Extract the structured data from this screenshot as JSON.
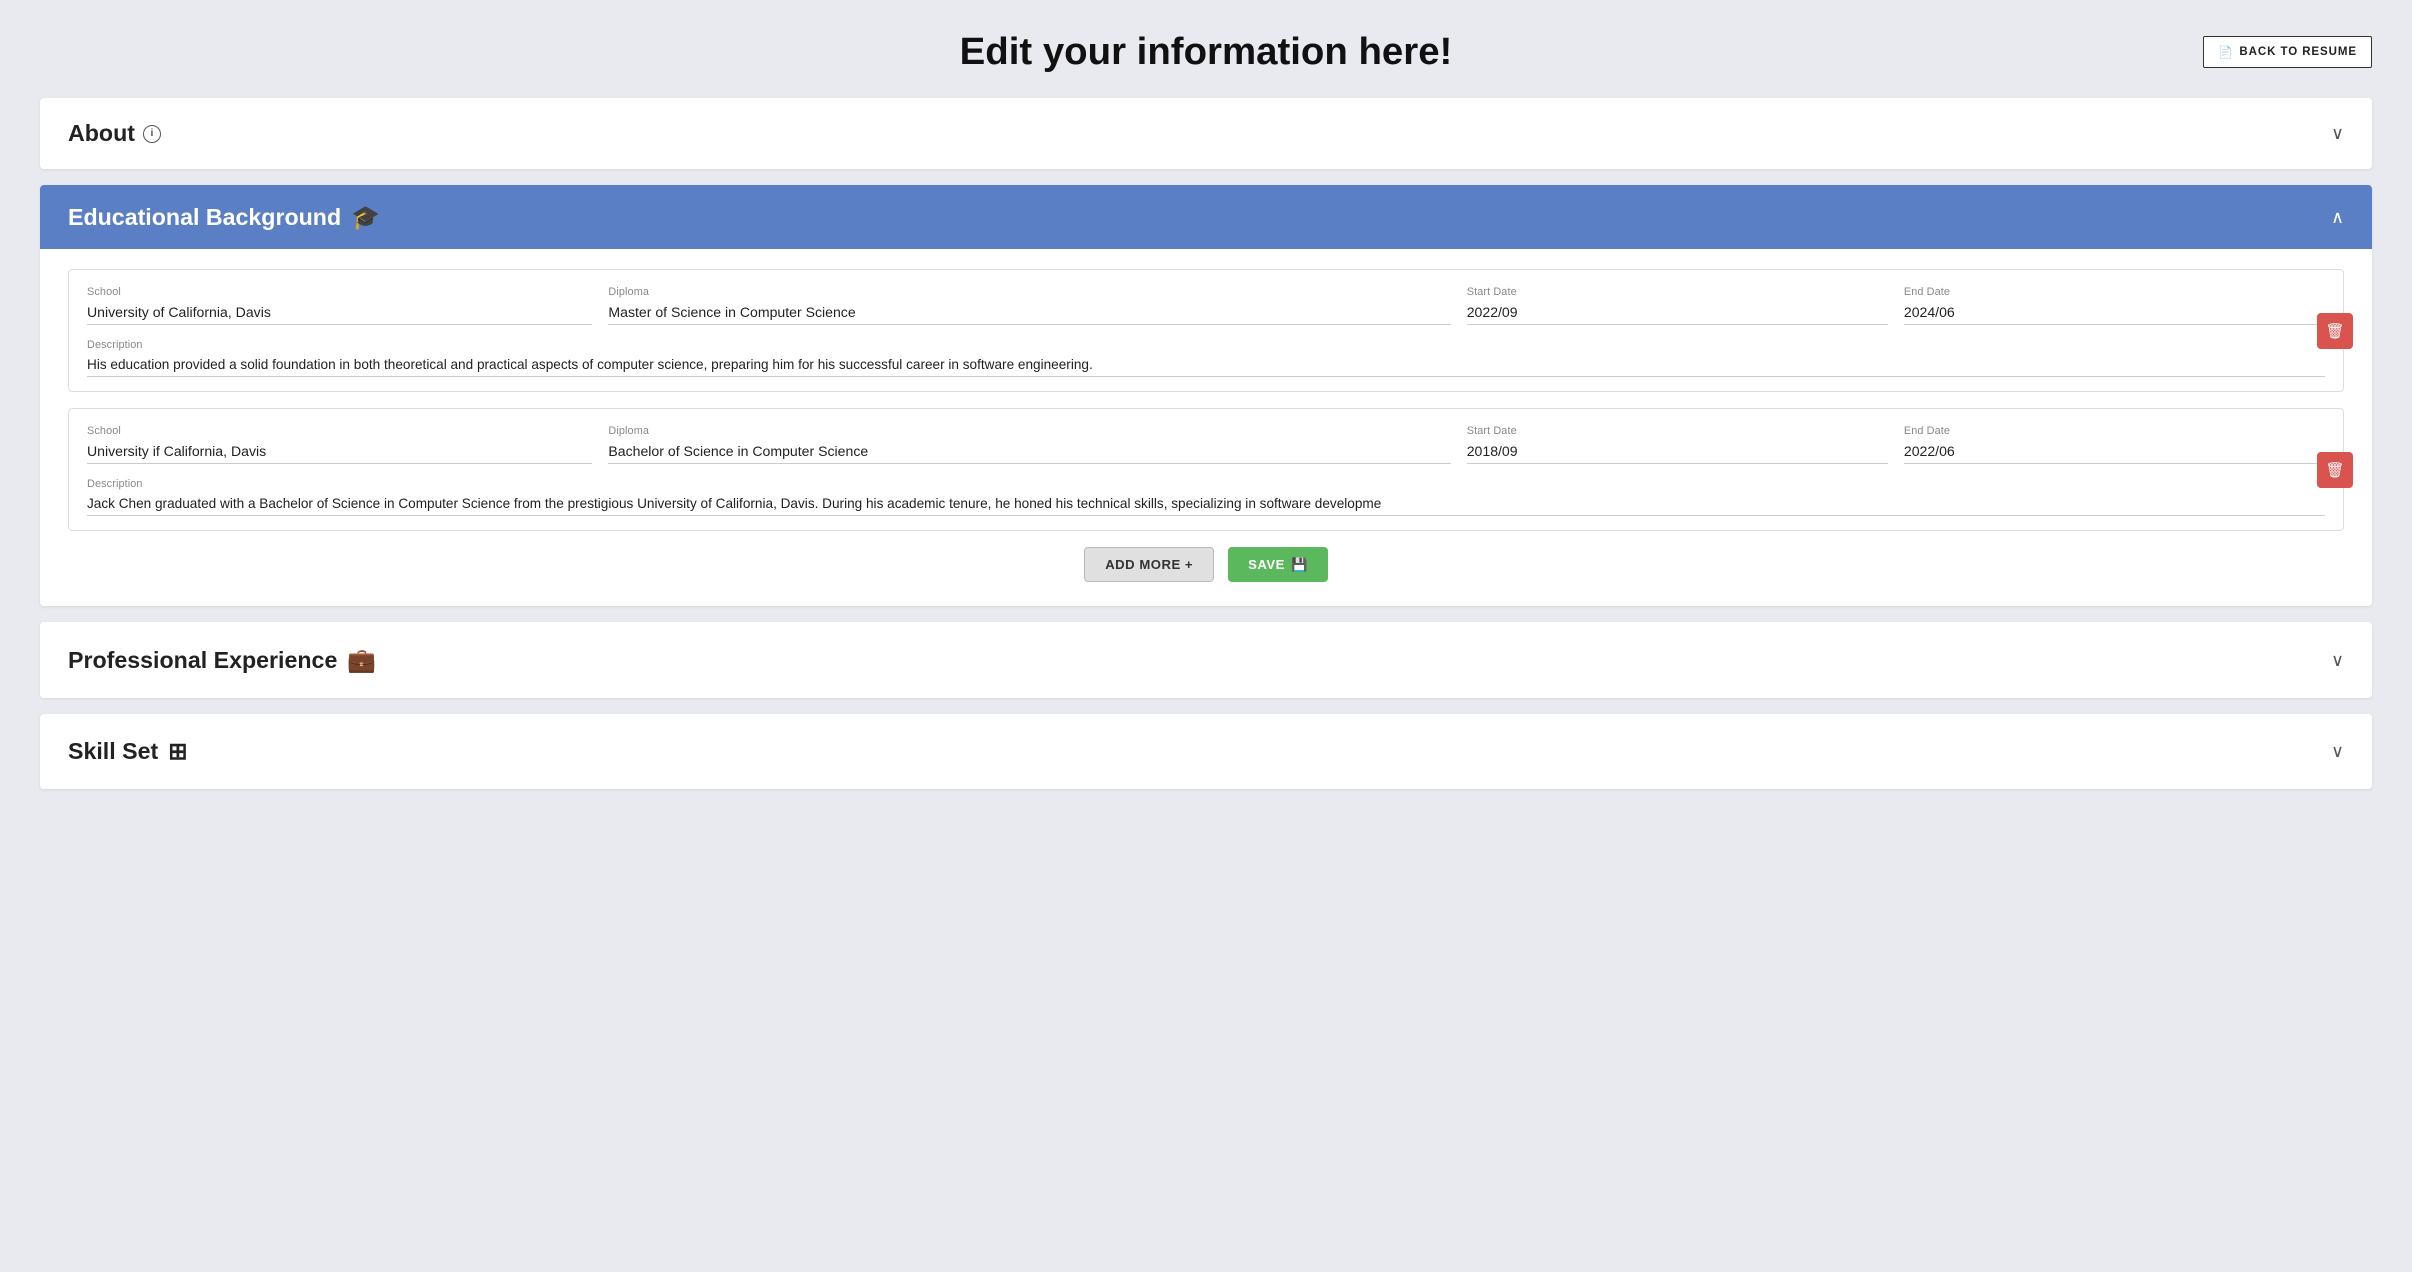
{
  "header": {
    "title": "Edit your information here!",
    "back_button_label": "BACK TO RESUME",
    "back_button_icon": "📄"
  },
  "about_section": {
    "title": "About",
    "info_icon": "ℹ",
    "chevron": "∨"
  },
  "educational_section": {
    "title": "Educational Background",
    "icon": "🎓",
    "chevron": "∧",
    "entries": [
      {
        "school_label": "School",
        "school_value": "University of California, Davis",
        "diploma_label": "Diploma",
        "diploma_value": "Master of Science in Computer Science",
        "start_date_label": "Start Date",
        "start_date_value": "2022/09",
        "end_date_label": "End Date",
        "end_date_value": "2024/06",
        "description_label": "Description",
        "description_value": "His education provided a solid foundation in both theoretical and practical aspects of computer science, preparing him for his successful career in software engineering."
      },
      {
        "school_label": "School",
        "school_value": "University if California, Davis",
        "diploma_label": "Diploma",
        "diploma_value": "Bachelor of Science in Computer Science",
        "start_date_label": "Start Date",
        "start_date_value": "2018/09",
        "end_date_label": "End Date",
        "end_date_value": "2022/06",
        "description_label": "Description",
        "description_value": "Jack Chen graduated with a Bachelor of Science in Computer Science from the prestigious University of California, Davis. During his academic tenure, he honed his technical skills, specializing in software developme"
      }
    ],
    "add_more_label": "ADD MORE +",
    "save_label": "SAVE 💾"
  },
  "professional_section": {
    "title": "Professional Experience",
    "icon": "💼",
    "chevron": "∨"
  },
  "skills_section": {
    "title": "Skill Set",
    "icon": "⊞",
    "chevron": "∨"
  }
}
